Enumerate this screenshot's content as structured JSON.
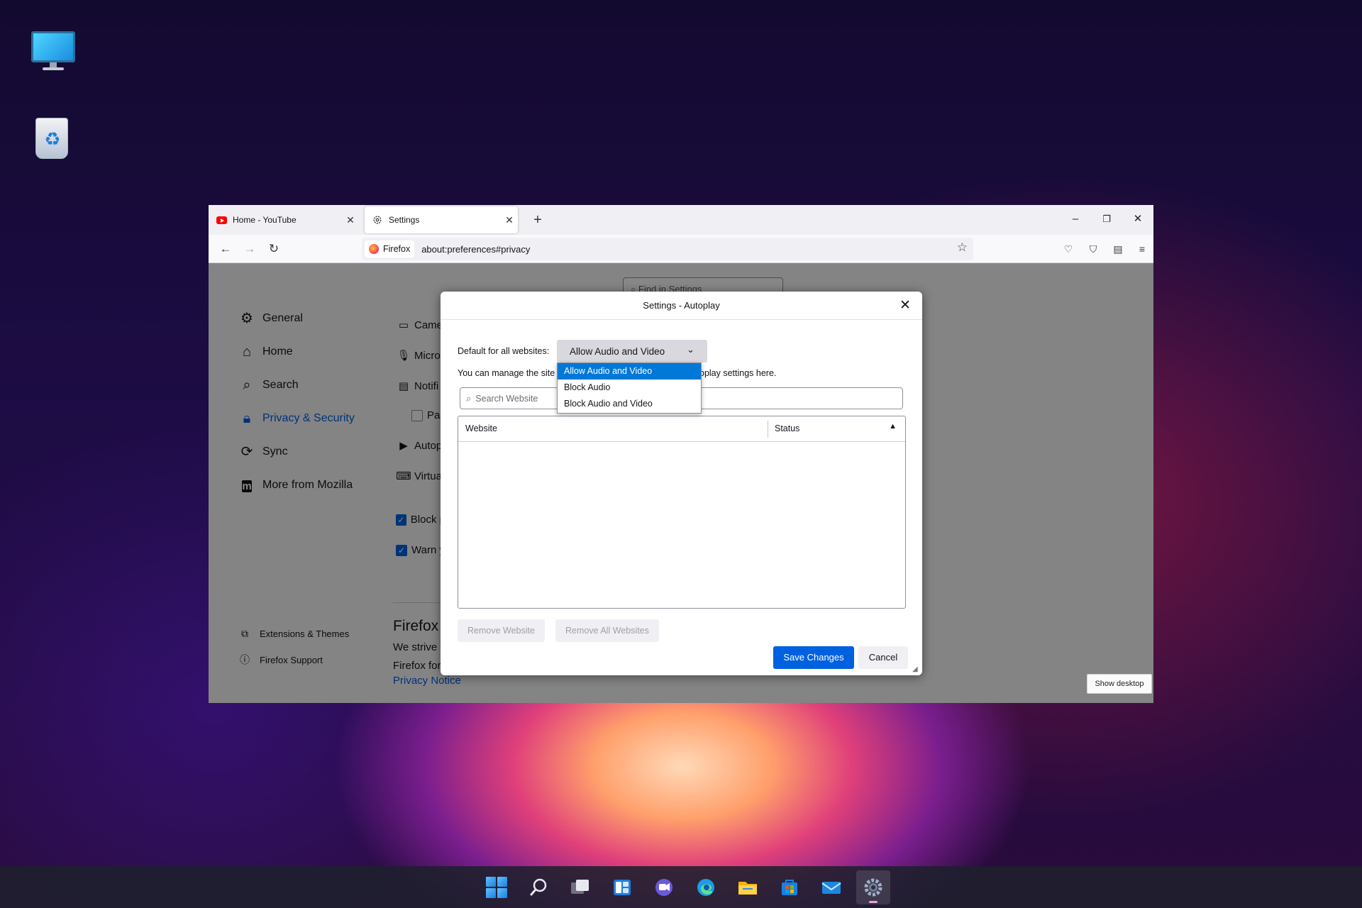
{
  "browser": {
    "tabs": [
      {
        "title": "Home - YouTube",
        "icon": "youtube-icon"
      },
      {
        "title": "Settings",
        "icon": "gear-icon"
      }
    ],
    "identity_label": "Firefox",
    "url": "about:preferences#privacy"
  },
  "settings": {
    "search_placeholder": "Find in Settings",
    "categories": [
      {
        "label": "General",
        "icon": "gear-icon"
      },
      {
        "label": "Home",
        "icon": "home-icon"
      },
      {
        "label": "Search",
        "icon": "search-icon"
      },
      {
        "label": "Privacy & Security",
        "icon": "lock-icon"
      },
      {
        "label": "Sync",
        "icon": "sync-icon"
      },
      {
        "label": "More from Mozilla",
        "icon": "mozilla-icon"
      }
    ],
    "footer_links": [
      {
        "label": "Extensions & Themes",
        "icon": "puzzle-icon"
      },
      {
        "label": "Firefox Support",
        "icon": "help-icon"
      }
    ],
    "permissions": [
      "Came",
      "Micro",
      "Notifi",
      "Pau",
      "Autop",
      "Virtua"
    ],
    "checkboxes": [
      "Block p",
      "Warn y"
    ],
    "section_title": "Firefox",
    "section_lines": [
      "We strive t",
      "Firefox for"
    ],
    "privacy_notice": "Privacy Notice"
  },
  "dialog": {
    "title": "Settings - Autoplay",
    "default_label": "Default for all websites:",
    "selected_option": "Allow Audio and Video",
    "manage_text_left": "You can manage the site",
    "manage_text_right": "oplay settings here.",
    "search_placeholder": "Search Website",
    "columns": [
      "Website",
      "Status"
    ],
    "options": [
      "Allow Audio and Video",
      "Block Audio",
      "Block Audio and Video"
    ],
    "remove_website": "Remove Website",
    "remove_all": "Remove All Websites",
    "save": "Save Changes",
    "cancel": "Cancel"
  },
  "desktop": {
    "show_desktop": "Show desktop"
  },
  "taskbar": {
    "items": [
      "start",
      "search",
      "task-view",
      "widgets",
      "chat",
      "edge",
      "file-explorer",
      "store",
      "mail",
      "settings"
    ],
    "active": "settings"
  },
  "colors": {
    "accent": "#0061e0",
    "dropdown_highlight": "#0078d7"
  }
}
